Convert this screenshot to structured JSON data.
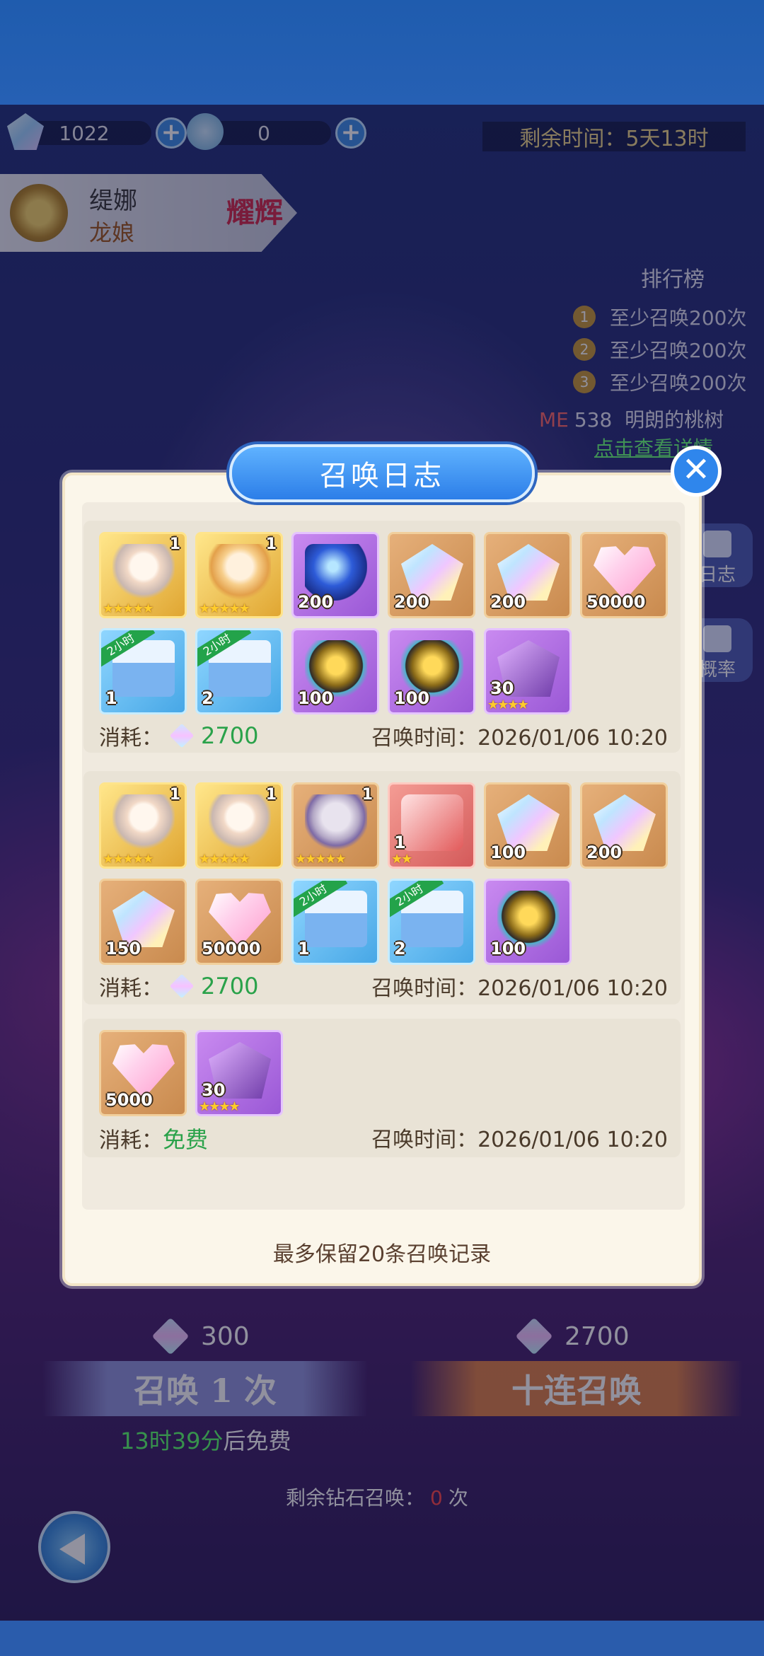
{
  "hud": {
    "diamonds": "1022",
    "scales": "0",
    "timer": "剩余时间：5天13时"
  },
  "hero": {
    "name": "缇娜",
    "subtitle": "龙娘",
    "badge": "耀辉"
  },
  "leaderboard": {
    "title": "排行榜",
    "rows": [
      {
        "rank": "1",
        "text": "至少召唤200次"
      },
      {
        "rank": "2",
        "text": "至少召唤200次"
      },
      {
        "rank": "3",
        "text": "至少召唤200次"
      }
    ],
    "me_label": "ME",
    "me_score": "538",
    "me_name": "明朗的桃树",
    "view_link": "点击查看详情"
  },
  "side_buttons": {
    "log": "日志",
    "rate": "概率"
  },
  "bottom": {
    "single_cost": "300",
    "ten_cost": "2700",
    "single_label": "召唤 1 次",
    "ten_label": "十连召唤",
    "free_countdown": "13时39分",
    "free_suffix": "后免费",
    "remain_prefix": "剩余钻石召唤：",
    "remain_count": "0",
    "remain_suffix": "次"
  },
  "modal": {
    "title": "召唤日志",
    "close": "✕",
    "footer": "最多保留20条召唤记录",
    "cost_label": "消耗：",
    "time_label": "召唤时间：",
    "records": [
      {
        "cost": "2700",
        "free": false,
        "time": "2026/01/06 10:20",
        "items": [
          {
            "type": "hero",
            "frame": "gold",
            "count": "1",
            "stars": "★★★★★"
          },
          {
            "type": "heroB",
            "frame": "gold",
            "count": "1",
            "stars": "★★★★★"
          },
          {
            "type": "orb",
            "frame": "purple",
            "num": "200"
          },
          {
            "type": "crystal",
            "frame": "brown",
            "num": "200"
          },
          {
            "type": "crystal",
            "frame": "brown",
            "num": "200"
          },
          {
            "type": "heart",
            "frame": "brown",
            "num": "50000"
          },
          {
            "type": "chest",
            "frame": "blue",
            "num": "1",
            "tag": "2小时"
          },
          {
            "type": "chest",
            "frame": "blue",
            "num": "2",
            "tag": "2小时"
          },
          {
            "type": "egg",
            "frame": "purple",
            "num": "100"
          },
          {
            "type": "egg",
            "frame": "purple",
            "num": "100"
          },
          {
            "type": "shard",
            "frame": "purple",
            "num": "30",
            "stars": "★★★★"
          }
        ]
      },
      {
        "cost": "2700",
        "free": false,
        "time": "2026/01/06 10:20",
        "items": [
          {
            "type": "hero",
            "frame": "gold",
            "count": "1",
            "stars": "★★★★★"
          },
          {
            "type": "hero",
            "frame": "gold",
            "count": "1",
            "stars": "★★★★★"
          },
          {
            "type": "heroR",
            "frame": "brown",
            "count": "1",
            "stars": "★★★★★"
          },
          {
            "type": "box",
            "frame": "red",
            "num": "1",
            "stars": "★★"
          },
          {
            "type": "crystal",
            "frame": "brown",
            "num": "100"
          },
          {
            "type": "crystal",
            "frame": "brown",
            "num": "200"
          },
          {
            "type": "crystal",
            "frame": "brown",
            "num": "150"
          },
          {
            "type": "heart",
            "frame": "brown",
            "num": "50000"
          },
          {
            "type": "chest",
            "frame": "blue",
            "num": "1",
            "tag": "2小时"
          },
          {
            "type": "chest",
            "frame": "blue",
            "num": "2",
            "tag": "2小时"
          },
          {
            "type": "egg",
            "frame": "purple",
            "num": "100"
          }
        ]
      },
      {
        "cost": "免费",
        "free": true,
        "time": "2026/01/06 10:20",
        "items": [
          {
            "type": "heart",
            "frame": "brown",
            "num": "5000"
          },
          {
            "type": "shard",
            "frame": "purple",
            "num": "30",
            "stars": "★★★★"
          }
        ]
      }
    ]
  },
  "colors": {
    "accent": "#2f86ec",
    "free_text": "#2aa24a",
    "modal_bg": "#fbf6ea"
  }
}
